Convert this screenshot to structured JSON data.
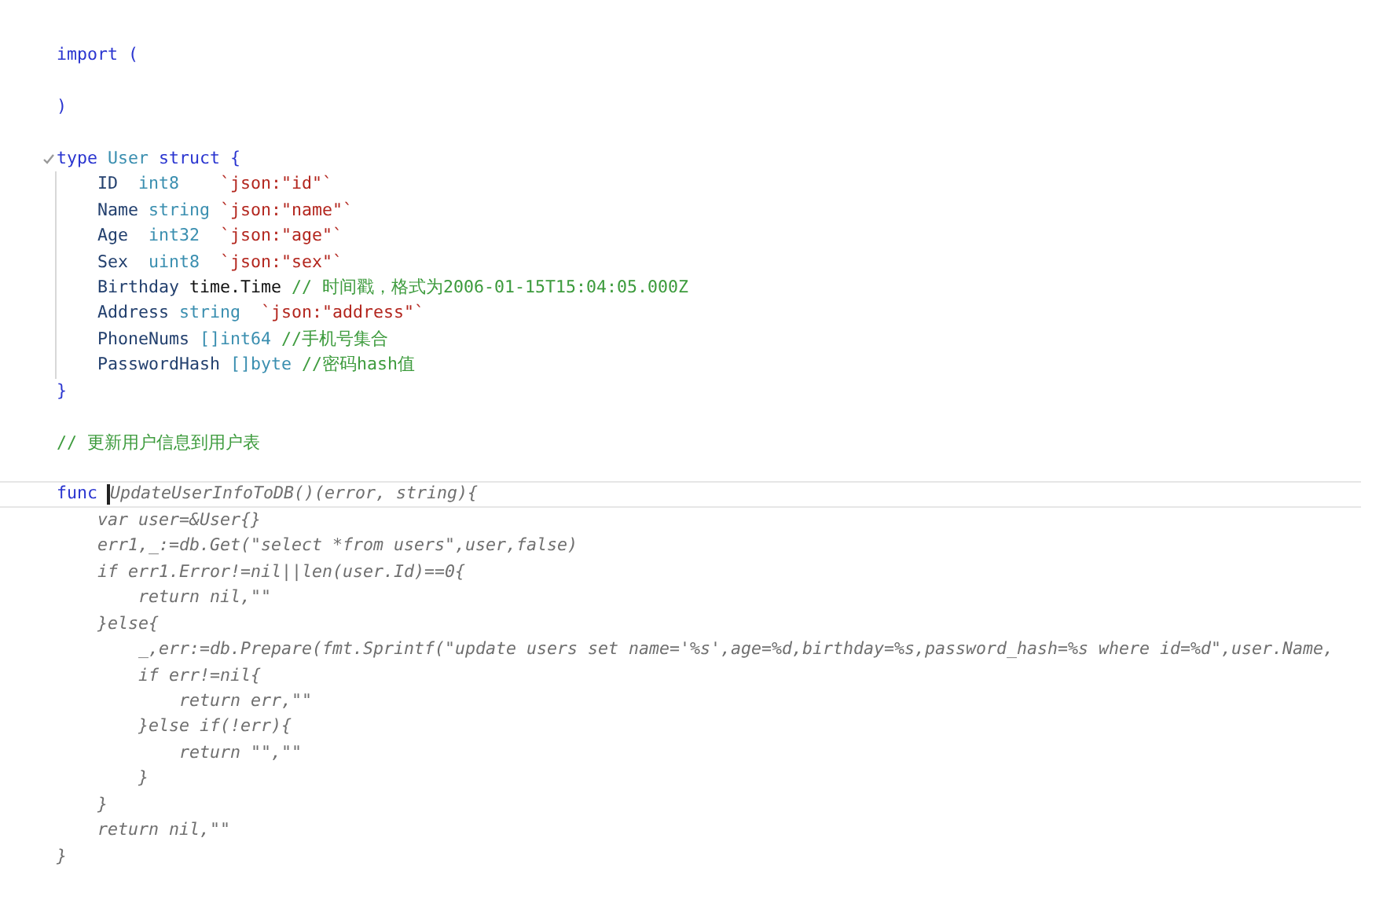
{
  "editor": {
    "lines": [
      {
        "tokens": [
          {
            "text": "import",
            "kind": "keyword"
          },
          {
            "text": " (",
            "kind": "keyword"
          }
        ]
      },
      {
        "gap_before": true,
        "tokens": [
          {
            "text": ")",
            "kind": "keyword"
          }
        ]
      },
      {
        "gap_before": true,
        "fold_marker": true,
        "tokens": [
          {
            "text": "type",
            "kind": "keyword"
          },
          {
            "text": " User",
            "kind": "type"
          },
          {
            "text": " struct {",
            "kind": "keyword"
          }
        ]
      },
      {
        "guide": true,
        "tokens": [
          {
            "text": "    ID",
            "kind": "ident"
          },
          {
            "text": "  int8",
            "kind": "type"
          },
          {
            "text": "    `json:\"id\"`",
            "kind": "tag"
          }
        ]
      },
      {
        "guide": true,
        "tokens": [
          {
            "text": "    Name",
            "kind": "ident"
          },
          {
            "text": " string",
            "kind": "type"
          },
          {
            "text": " `json:\"name\"`",
            "kind": "tag"
          }
        ]
      },
      {
        "guide": true,
        "tokens": [
          {
            "text": "    Age",
            "kind": "ident"
          },
          {
            "text": "  int32",
            "kind": "type"
          },
          {
            "text": "  `json:\"age\"`",
            "kind": "tag"
          }
        ]
      },
      {
        "guide": true,
        "tokens": [
          {
            "text": "    Sex",
            "kind": "ident"
          },
          {
            "text": "  uint8",
            "kind": "type"
          },
          {
            "text": "  `json:\"sex\"`",
            "kind": "tag"
          }
        ]
      },
      {
        "guide": true,
        "tokens": [
          {
            "text": "    Birthday",
            "kind": "ident"
          },
          {
            "text": " time.Time",
            "kind": "plain"
          },
          {
            "text": " // 时间戳，格式为2006-01-15T15:04:05.000Z",
            "kind": "comment"
          }
        ]
      },
      {
        "guide": true,
        "tokens": [
          {
            "text": "    Address",
            "kind": "ident"
          },
          {
            "text": " string",
            "kind": "type"
          },
          {
            "text": "  `json:\"address\"`",
            "kind": "tag"
          }
        ]
      },
      {
        "guide": true,
        "tokens": [
          {
            "text": "    PhoneNums",
            "kind": "ident"
          },
          {
            "text": " []int64",
            "kind": "type"
          },
          {
            "text": " //手机号集合",
            "kind": "comment"
          }
        ]
      },
      {
        "guide": true,
        "tokens": [
          {
            "text": "    PasswordHash",
            "kind": "ident"
          },
          {
            "text": " []byte",
            "kind": "type"
          },
          {
            "text": " //密码hash值",
            "kind": "comment"
          }
        ]
      },
      {
        "tokens": [
          {
            "text": "}",
            "kind": "keyword"
          }
        ]
      },
      {
        "gap_before": true,
        "tokens": [
          {
            "text": "// 更新用户信息到用户表",
            "kind": "comment"
          }
        ]
      },
      {
        "gap_before": true,
        "current": true,
        "tokens": [
          {
            "text": "func",
            "kind": "keyword"
          },
          {
            "kind": "cursor"
          },
          {
            "text": "UpdateUserInfoToDB()(error, string){",
            "kind": "italic"
          }
        ]
      },
      {
        "tokens": [
          {
            "text": "    var user=&User{}",
            "kind": "italic"
          }
        ]
      },
      {
        "tokens": [
          {
            "text": "    err1,_:=db.Get(\"select *from users\",user,false)",
            "kind": "italic"
          }
        ]
      },
      {
        "tokens": [
          {
            "text": "    if err1.Error!=nil||len(user.Id)==0{",
            "kind": "italic"
          }
        ]
      },
      {
        "tokens": [
          {
            "text": "        return nil,\"\"",
            "kind": "italic"
          }
        ]
      },
      {
        "tokens": [
          {
            "text": "    }else{",
            "kind": "italic"
          }
        ]
      },
      {
        "tokens": [
          {
            "text": "        _,err:=db.Prepare(fmt.Sprintf(\"update users set name='%s',age=%d,birthday=%s,password_hash=%s where id=%d\",user.Name,",
            "kind": "italic"
          }
        ]
      },
      {
        "tokens": [
          {
            "text": "        if err!=nil{",
            "kind": "italic"
          }
        ]
      },
      {
        "tokens": [
          {
            "text": "            return err,\"\"",
            "kind": "italic"
          }
        ]
      },
      {
        "tokens": [
          {
            "text": "        }else if(!err){",
            "kind": "italic"
          }
        ]
      },
      {
        "tokens": [
          {
            "text": "            return \"\",\"\"",
            "kind": "italic"
          }
        ]
      },
      {
        "tokens": [
          {
            "text": "        }",
            "kind": "italic"
          }
        ]
      },
      {
        "tokens": [
          {
            "text": "    }",
            "kind": "italic"
          }
        ]
      },
      {
        "tokens": [
          {
            "text": "    return nil,\"\"",
            "kind": "italic"
          }
        ]
      },
      {
        "tokens": [
          {
            "text": "}",
            "kind": "italic"
          }
        ]
      }
    ]
  }
}
